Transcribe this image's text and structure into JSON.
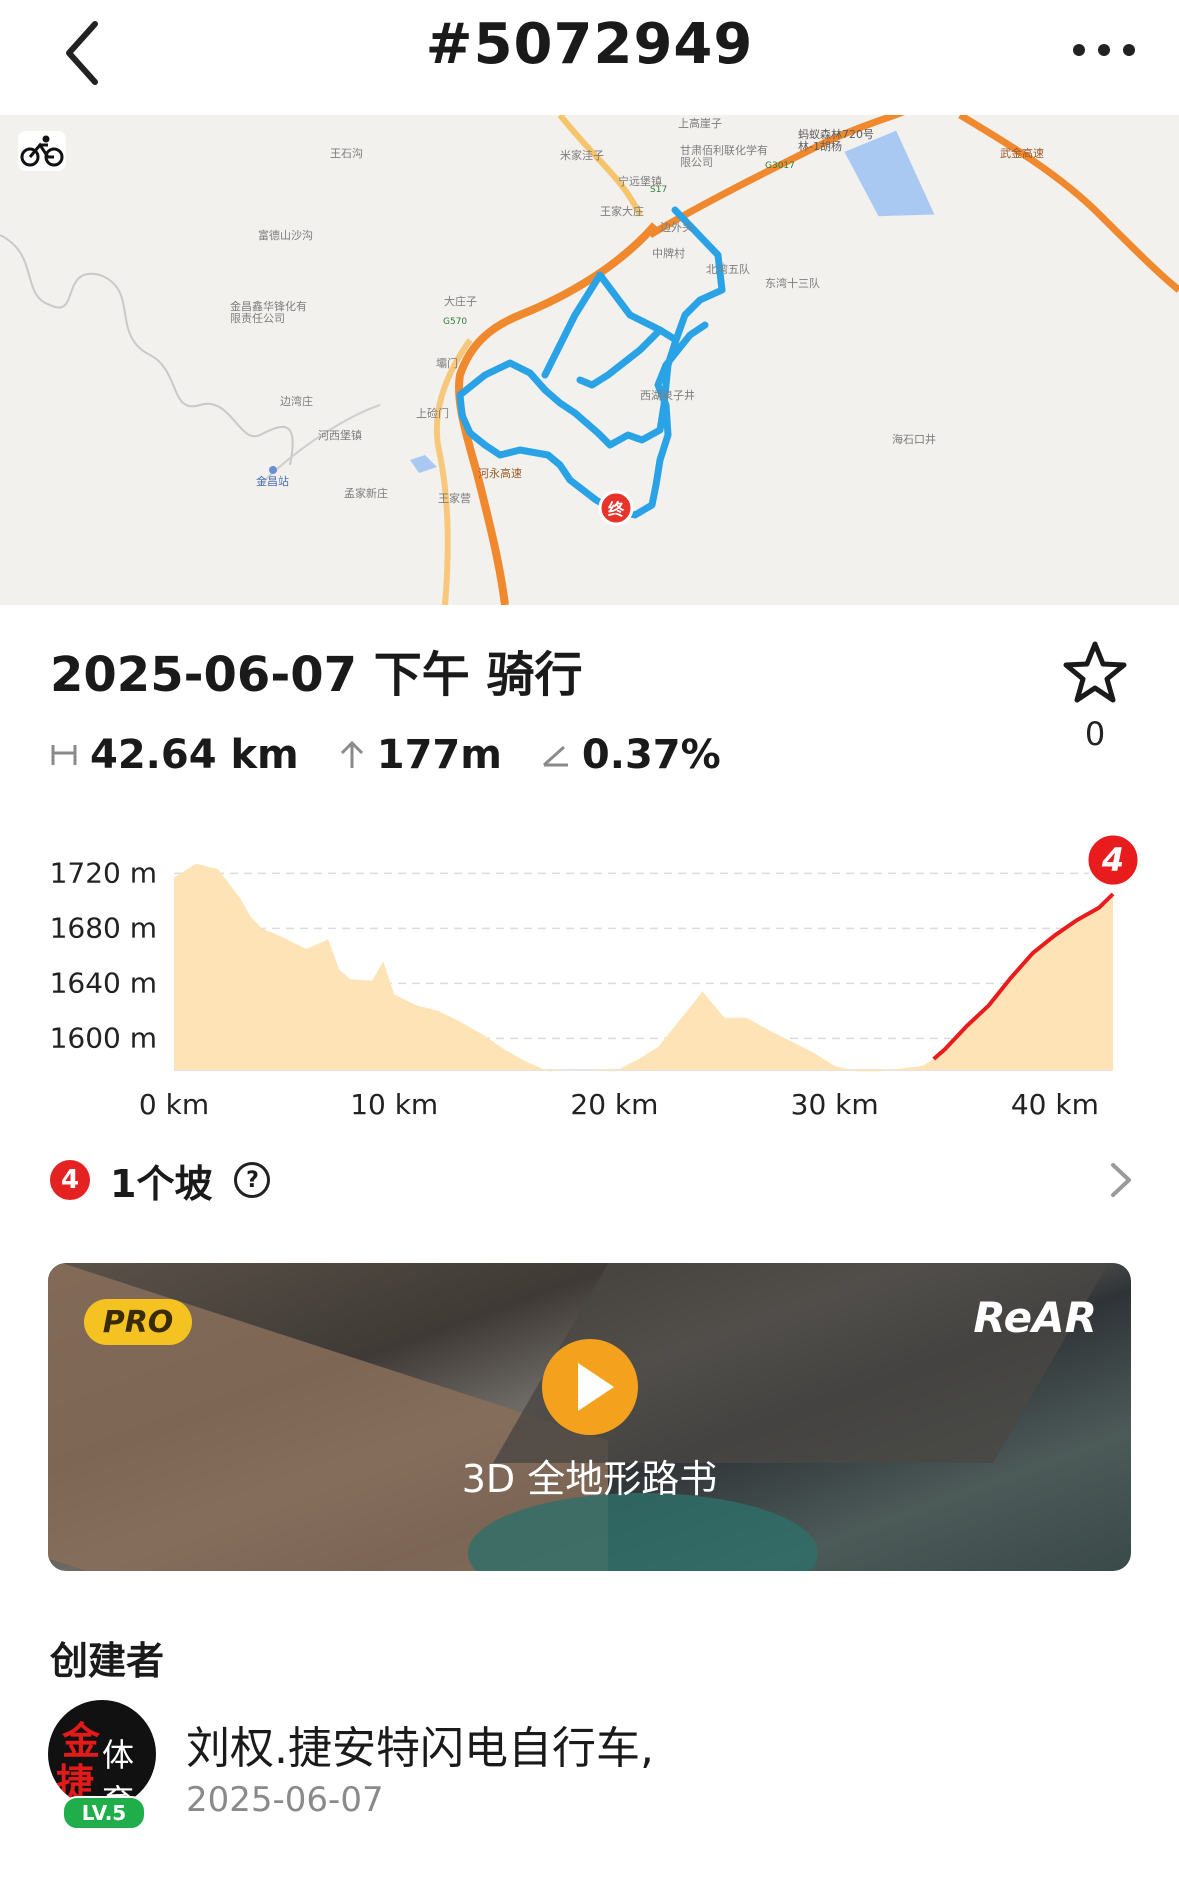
{
  "header": {
    "title": "#5072949",
    "back_icon": "chevron-left-icon",
    "more_icon": "more-dots-icon"
  },
  "map": {
    "mode_icon": "bicycle-icon",
    "end_marker": "终",
    "route_color": "#2aa3e6",
    "highway_color": "#f0892e",
    "labels": [
      "王石沟",
      "米家洼子",
      "宁远堡镇",
      "上高崖子",
      "甘肃佰利联化学有限公司",
      "蚂蚁森林720号林-1胡杨",
      "G3017",
      "S17",
      "武金高速",
      "富德山沙沟",
      "王家大庄",
      "边外头",
      "中牌村",
      "北湾五队",
      "东湾十三队",
      "金昌鑫华锋化有限责任公司",
      "大庄子",
      "G570",
      "壩门",
      "西湖泉子井",
      "边湾庄",
      "河西堡镇",
      "上硷门",
      "海石口井",
      "金昌站",
      "孟家新庄",
      "王家营",
      "河永高速"
    ]
  },
  "activity": {
    "title": "2025-06-07 下午 骑行",
    "distance": "42.64 km",
    "climb": "177m",
    "grade": "0.37%",
    "favorite_count": "0"
  },
  "chart_data": {
    "type": "area",
    "xlabel": "",
    "ylabel": "",
    "x_ticks": [
      "0 km",
      "10 km",
      "20 km",
      "30 km",
      "40 km"
    ],
    "y_ticks": [
      "1600 m",
      "1640 m",
      "1680 m",
      "1720 m"
    ],
    "xlim": [
      0,
      42.64
    ],
    "ylim": [
      1577,
      1737
    ],
    "fill_color": "#fde3b5",
    "climb_color": "#e81c1c",
    "x": [
      0,
      1,
      2,
      3,
      3.5,
      4,
      5,
      6,
      7,
      7.5,
      8,
      9,
      9.5,
      10,
      11,
      12,
      13,
      14,
      15,
      16,
      17,
      18,
      19,
      20,
      21,
      22,
      23,
      24,
      25,
      26,
      27,
      28,
      29,
      30,
      31,
      32,
      33,
      34,
      34.5,
      35,
      36,
      37,
      38,
      39,
      40,
      41,
      42,
      42.64
    ],
    "values": [
      1717,
      1727,
      1723,
      1702,
      1688,
      1680,
      1673,
      1665,
      1672,
      1650,
      1643,
      1642,
      1656,
      1632,
      1624,
      1620,
      1612,
      1603,
      1592,
      1583,
      1576,
      1577,
      1577,
      1576,
      1584,
      1594,
      1614,
      1634,
      1615,
      1615,
      1606,
      1598,
      1590,
      1580,
      1576,
      1576,
      1578,
      1580,
      1585,
      1592,
      1609,
      1624,
      1644,
      1662,
      1675,
      1686,
      1695,
      1705
    ],
    "climb": {
      "number": "4",
      "start_km": 34.5,
      "end_km": 42.64
    }
  },
  "climbs": {
    "badge": "4",
    "label": "1个坡",
    "help_icon": "question-circle-icon"
  },
  "banner": {
    "pro_label": "PRO",
    "logo": "ReAR",
    "text": "3D 全地形路书"
  },
  "creator": {
    "heading": "创建者",
    "avatar_text": [
      "金",
      "捷",
      "体育"
    ],
    "level": "LV.5",
    "name": "刘权.捷安特闪电自行车,",
    "date": "2025-06-07"
  }
}
